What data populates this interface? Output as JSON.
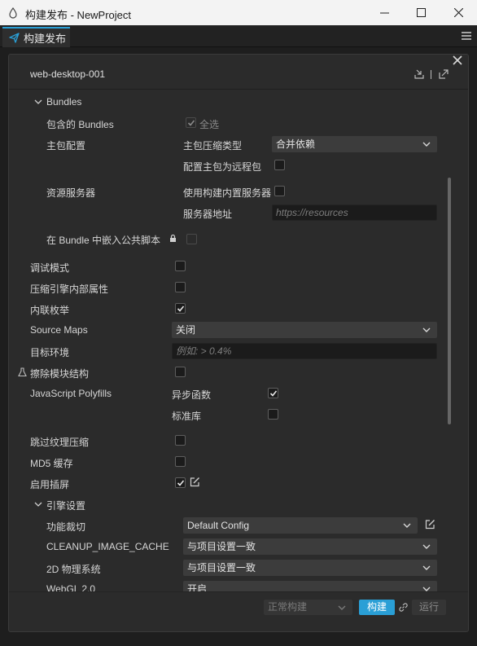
{
  "window": {
    "title": "构建发布 - NewProject"
  },
  "tab": {
    "label": "构建发布"
  },
  "header": {
    "preset": "web-desktop-001"
  },
  "bundles": {
    "section_label": "Bundles",
    "included_label": "包含的 Bundles",
    "select_all_label": "全选",
    "main_config_label": "主包配置",
    "compression_label": "主包压缩类型",
    "compression_value": "合并依赖",
    "remote_label": "配置主包为远程包",
    "resource_server_label": "资源服务器",
    "use_builtin_server_label": "使用构建内置服务器",
    "server_address_label": "服务器地址",
    "server_address_placeholder": "https://resources",
    "embed_script_label": "在 Bundle 中嵌入公共脚本"
  },
  "options": {
    "debug_label": "调试模式",
    "compress_props_label": "压缩引擎内部属性",
    "inline_enum_label": "内联枚举",
    "source_maps_label": "Source Maps",
    "source_maps_value": "关闭",
    "target_env_label": "目标环境",
    "target_env_placeholder": "例如: > 0.4%",
    "erase_modules_label": "擦除模块结构",
    "polyfills_label": "JavaScript Polyfills",
    "async_label": "异步函数",
    "stdlib_label": "标准库",
    "skip_texture_label": "跳过纹理压缩",
    "md5_label": "MD5 缓存",
    "splash_label": "启用插屏"
  },
  "engine": {
    "section_label": "引擎设置",
    "feature_crop_label": "功能裁切",
    "feature_crop_value": "Default Config",
    "cleanup_label": "CLEANUP_IMAGE_CACHE",
    "cleanup_value": "与项目设置一致",
    "physics2d_label": "2D 物理系统",
    "physics2d_value": "与项目设置一致",
    "webgl2_label": "WebGL 2.0",
    "webgl2_value": "开启"
  },
  "footer": {
    "build_mode": "正常构建",
    "build_label": "构建",
    "run_label": "运行"
  },
  "colors": {
    "accent": "#2a9fd6",
    "panel": "#2b2b2b",
    "titlebar": "#f3f3f3"
  }
}
